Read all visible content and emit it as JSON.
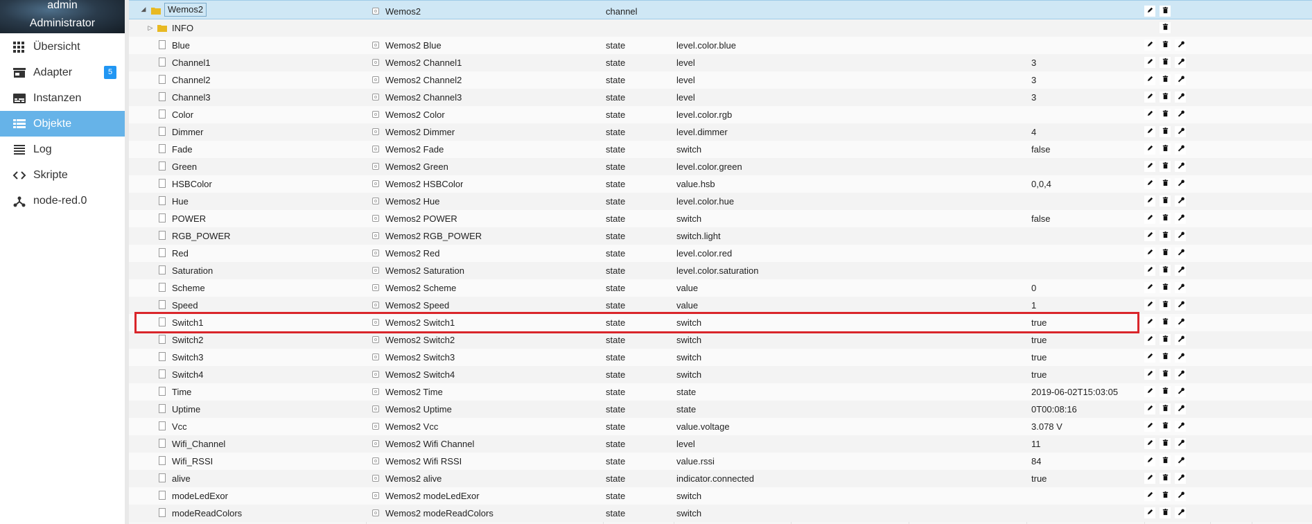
{
  "user": {
    "name": "admin",
    "role": "Administrator"
  },
  "nav": [
    {
      "label": "Übersicht",
      "icon": "grid-icon"
    },
    {
      "label": "Adapter",
      "icon": "store-icon",
      "badge": "5"
    },
    {
      "label": "Instanzen",
      "icon": "instances-icon"
    },
    {
      "label": "Objekte",
      "icon": "list-icon",
      "active": true
    },
    {
      "label": "Log",
      "icon": "log-icon"
    },
    {
      "label": "Skripte",
      "icon": "code-icon"
    },
    {
      "label": "node-red.0",
      "icon": "node-icon"
    }
  ],
  "parent_row": {
    "id": "Wemos2",
    "name": "Wemos2",
    "type": "channel"
  },
  "info_row": {
    "id": "INFO"
  },
  "rows": [
    {
      "id": "Blue",
      "name": "Wemos2 Blue",
      "type": "state",
      "role": "level.color.blue",
      "value": ""
    },
    {
      "id": "Channel1",
      "name": "Wemos2 Channel1",
      "type": "state",
      "role": "level",
      "value": "3"
    },
    {
      "id": "Channel2",
      "name": "Wemos2 Channel2",
      "type": "state",
      "role": "level",
      "value": "3"
    },
    {
      "id": "Channel3",
      "name": "Wemos2 Channel3",
      "type": "state",
      "role": "level",
      "value": "3"
    },
    {
      "id": "Color",
      "name": "Wemos2 Color",
      "type": "state",
      "role": "level.color.rgb",
      "value": ""
    },
    {
      "id": "Dimmer",
      "name": "Wemos2 Dimmer",
      "type": "state",
      "role": "level.dimmer",
      "value": "4"
    },
    {
      "id": "Fade",
      "name": "Wemos2 Fade",
      "type": "state",
      "role": "switch",
      "value": "false"
    },
    {
      "id": "Green",
      "name": "Wemos2 Green",
      "type": "state",
      "role": "level.color.green",
      "value": ""
    },
    {
      "id": "HSBColor",
      "name": "Wemos2 HSBColor",
      "type": "state",
      "role": "value.hsb",
      "value": "0,0,4"
    },
    {
      "id": "Hue",
      "name": "Wemos2 Hue",
      "type": "state",
      "role": "level.color.hue",
      "value": ""
    },
    {
      "id": "POWER",
      "name": "Wemos2 POWER",
      "type": "state",
      "role": "switch",
      "value": "false"
    },
    {
      "id": "RGB_POWER",
      "name": "Wemos2 RGB_POWER",
      "type": "state",
      "role": "switch.light",
      "value": ""
    },
    {
      "id": "Red",
      "name": "Wemos2 Red",
      "type": "state",
      "role": "level.color.red",
      "value": ""
    },
    {
      "id": "Saturation",
      "name": "Wemos2 Saturation",
      "type": "state",
      "role": "level.color.saturation",
      "value": ""
    },
    {
      "id": "Scheme",
      "name": "Wemos2 Scheme",
      "type": "state",
      "role": "value",
      "value": "0"
    },
    {
      "id": "Speed",
      "name": "Wemos2 Speed",
      "type": "state",
      "role": "value",
      "value": "1"
    },
    {
      "id": "Switch1",
      "name": "Wemos2 Switch1",
      "type": "state",
      "role": "switch",
      "value": "true"
    },
    {
      "id": "Switch2",
      "name": "Wemos2 Switch2",
      "type": "state",
      "role": "switch",
      "value": "true"
    },
    {
      "id": "Switch3",
      "name": "Wemos2 Switch3",
      "type": "state",
      "role": "switch",
      "value": "true"
    },
    {
      "id": "Switch4",
      "name": "Wemos2 Switch4",
      "type": "state",
      "role": "switch",
      "value": "true"
    },
    {
      "id": "Time",
      "name": "Wemos2 Time",
      "type": "state",
      "role": "state",
      "value": "2019-06-02T15:03:05"
    },
    {
      "id": "Uptime",
      "name": "Wemos2 Uptime",
      "type": "state",
      "role": "state",
      "value": "0T00:08:16"
    },
    {
      "id": "Vcc",
      "name": "Wemos2 Vcc",
      "type": "state",
      "role": "value.voltage",
      "value": "3.078 V"
    },
    {
      "id": "Wifi_Channel",
      "name": "Wemos2 Wifi Channel",
      "type": "state",
      "role": "level",
      "value": "11"
    },
    {
      "id": "Wifi_RSSI",
      "name": "Wemos2 Wifi RSSI",
      "type": "state",
      "role": "value.rssi",
      "value": "84"
    },
    {
      "id": "alive",
      "name": "Wemos2 alive",
      "type": "state",
      "role": "indicator.connected",
      "value": "true"
    },
    {
      "id": "modeLedExor",
      "name": "Wemos2 modeLedExor",
      "type": "state",
      "role": "switch",
      "value": ""
    },
    {
      "id": "modeReadColors",
      "name": "Wemos2 modeReadColors",
      "type": "state",
      "role": "switch",
      "value": ""
    }
  ],
  "highlighted_row": "Switch1",
  "colors": {
    "active_nav": "#66b3e8",
    "badge": "#2196f3",
    "highlight": "#d9252a",
    "selected_row": "#cfe7f5"
  }
}
